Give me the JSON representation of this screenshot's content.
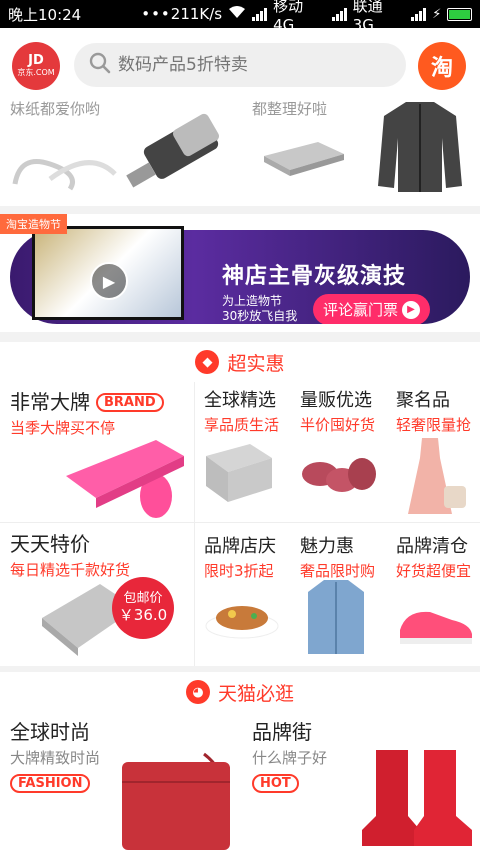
{
  "status_bar": {
    "time": "晚上10:24",
    "dots": "•••",
    "speed": "211K/s",
    "carrier1": "移动 4G",
    "carrier2": "联通 3G"
  },
  "header": {
    "logo_main": "JD",
    "logo_sub": "京东.COM",
    "search_placeholder": "数码产品5折特卖",
    "taobao_label": "淘"
  },
  "top_row": {
    "captions": [
      "妹纸都爱你哟",
      "都整理好啦"
    ]
  },
  "banner": {
    "tag": "淘宝造物节",
    "title": "神店主骨灰级演技",
    "sub_line1": "为上造物节",
    "sub_line2": "30秒放飞自我",
    "button": "评论赢门票"
  },
  "deals_section": {
    "title": "超实惠",
    "cells": [
      {
        "title": "非常大牌",
        "badge": "BRAND",
        "sub": "当季大牌买不停"
      },
      {
        "title": "全球精选",
        "sub": "享品质生活"
      },
      {
        "title": "量贩优选",
        "sub": "半价囤好货"
      },
      {
        "title": "聚名品",
        "sub": "轻奢限量抢"
      },
      {
        "title": "天天特价",
        "sub": "每日精选千款好货"
      },
      {
        "title": "品牌店庆",
        "sub": "限时3折起"
      },
      {
        "title": "魅力惠",
        "sub": "奢品限时购"
      },
      {
        "title": "品牌清仓",
        "sub": "好货超便宜"
      }
    ],
    "price_bubble": {
      "label": "包邮价",
      "price": "￥36.0"
    }
  },
  "tmall_section": {
    "title": "天猫必逛",
    "left": {
      "title": "全球时尚",
      "sub": "大牌精致时尚",
      "badge": "FASHION"
    },
    "right": {
      "title": "品牌街",
      "sub": "什么牌子好",
      "badge": "HOT"
    }
  },
  "colors": {
    "accent": "#ff3a2a",
    "jd_red": "#e4393c",
    "taobao_orange": "#ff5a1f"
  }
}
